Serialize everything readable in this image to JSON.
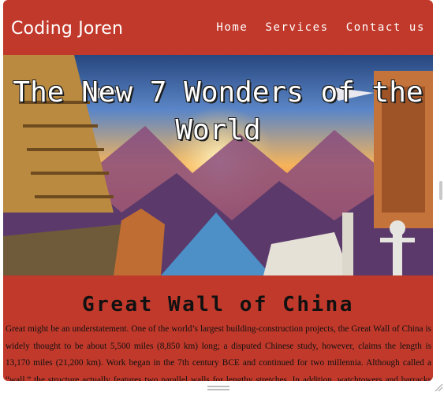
{
  "brand": "Coding Joren",
  "nav": {
    "home": "Home",
    "services": "Services",
    "contact": "Contact us"
  },
  "hero": {
    "title": "The New 7 Wonders of the World",
    "image": "wonders-landscape-illustration"
  },
  "section": {
    "title": "Great Wall of China",
    "body": "Great might be an understatement. One of the world’s largest building-construction projects, the Great Wall of China is widely thought to be about 5,500 miles (8,850 km) long; a disputed Chinese study, however, claims the length is 13,170 miles (21,200 km). Work began in the 7th century BCE and continued for two millennia. Although called a “wall,” the structure actually features two parallel walls for lengthy stretches. In addition, watchtowers and barracks dot the"
  },
  "colors": {
    "accent": "#c1392b",
    "text": "#111111",
    "nav_text": "#ffffff"
  }
}
